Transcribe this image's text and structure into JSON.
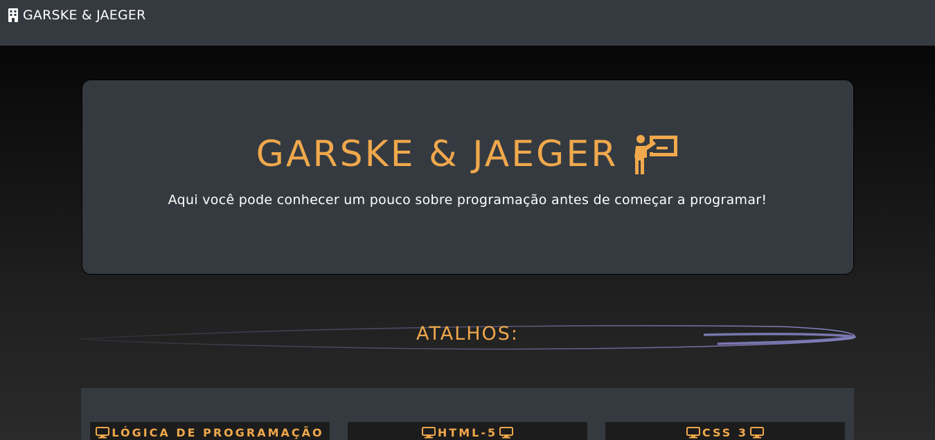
{
  "navbar": {
    "brand_label": "GARSKE & JAEGER",
    "brand_icon": "building-icon"
  },
  "hero": {
    "title": "GARSKE & JAEGER",
    "title_icon": "teacher-board-icon",
    "subtitle": "Aqui você pode conhecer um pouco sobre programação antes de começar a programar!"
  },
  "section": {
    "title": "ATALHOS:"
  },
  "shortcuts": [
    {
      "label": "LÓGICA DE PROGRAMAÇÃO",
      "icon": "desktop-icon"
    },
    {
      "label": "HTML-5",
      "icon": "desktop-icon"
    },
    {
      "label": "CSS 3",
      "icon": "desktop-icon"
    }
  ],
  "colors": {
    "accent": "#f0a84c",
    "panel": "#343a40",
    "swoosh": "#8a86c8"
  }
}
